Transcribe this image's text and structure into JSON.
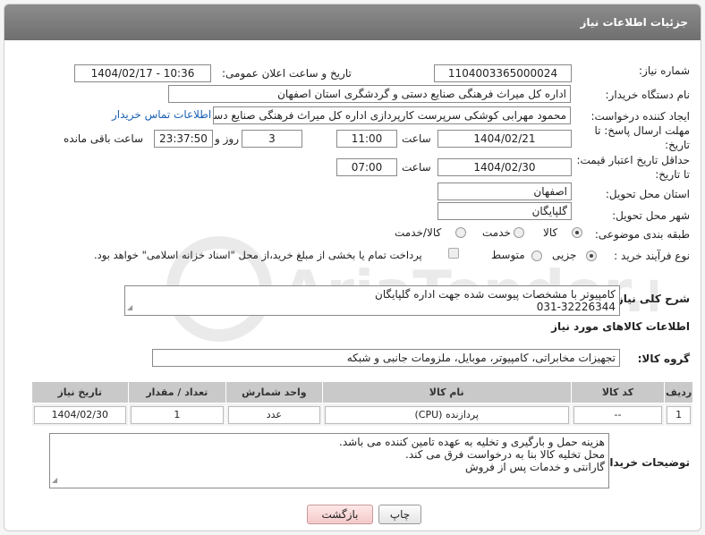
{
  "header": {
    "title": "جزئیات اطلاعات نیاز"
  },
  "fields": {
    "need_number": {
      "label": "شماره نیاز:",
      "value": "1104003365000024"
    },
    "announce": {
      "label": "تاریخ و ساعت اعلان عمومی:",
      "value": "1404/02/17 - 10:36"
    },
    "buyer_org": {
      "label": "نام دستگاه خریدار:",
      "value": "اداره کل میراث فرهنگی  صنایع دستی و گردشگری استان اصفهان"
    },
    "requester": {
      "label": "ایجاد کننده درخواست:",
      "value": "محمود مهرابی کوشکی سرپرست کارپردازی اداره کل میراث فرهنگی  صنایع دستی و گردشگری استان اصفهان",
      "contact_link": "اطلاعات تماس خریدار"
    },
    "reply_deadline": {
      "label_line1": "مهلت ارسال پاسخ: تا",
      "label_line2": "تاریخ:",
      "date": "1404/02/21",
      "time_label": "ساعت",
      "time": "11:00",
      "days": "3",
      "days_label": "روز و",
      "remaining": "23:37:50",
      "remaining_label": "ساعت باقی مانده"
    },
    "price_validity": {
      "label_line1": "حداقل تاریخ اعتبار قیمت:",
      "label_line2": "تا تاریخ:",
      "date": "1404/02/30",
      "time_label": "ساعت",
      "time": "07:00"
    },
    "province": {
      "label": "استان محل تحویل:",
      "value": "اصفهان"
    },
    "city": {
      "label": "شهر محل تحویل:",
      "value": "گلپایگان"
    },
    "category": {
      "label": "طبقه بندی موضوعی:",
      "options": [
        "کالا",
        "خدمت",
        "کالا/خدمت"
      ],
      "selected": "کالا"
    },
    "purchase_type": {
      "label": "نوع فرآیند خرید :",
      "options": [
        "جزیی",
        "متوسط"
      ],
      "selected": "جزیی",
      "note": "پرداخت تمام یا بخشی از مبلغ خرید،از محل \"اسناد خزانه اسلامی\" خواهد بود."
    }
  },
  "description": {
    "label": "شرح کلی نیاز:",
    "line1": "کامپیوتر با مشخصات پیوست شده جهت اداره گلپایگان",
    "line2": "031-32226344"
  },
  "goods_section": {
    "title": "اطلاعات کالاهای مورد نیاز"
  },
  "goods_group": {
    "label": "گروه کالا:",
    "value": "تجهیزات مخابراتی، کامپیوتر، موبایل، ملزومات جانبی و شبکه"
  },
  "table": {
    "headers": [
      "ردیف",
      "کد کالا",
      "نام کالا",
      "واحد شمارش",
      "تعداد / مقدار",
      "تاریخ نیاز"
    ],
    "rows": [
      {
        "row": "1",
        "code": "--",
        "name": "پردازنده (CPU)",
        "unit": "عدد",
        "qty": "1",
        "date": "1404/02/30"
      }
    ]
  },
  "buyer_notes": {
    "label": "توضیحات خریدار:",
    "lines": [
      "هزینه حمل و بارگیری و تخلیه به عهده تامین کننده می باشد.",
      "محل تخلیه کالا بنا به درخواست فرق می کند.",
      "گارانتی و خدمات پس از فروش"
    ]
  },
  "buttons": {
    "print": "چاپ",
    "back": "بازگشت"
  },
  "watermark": {
    "text": "AriaTender.neT"
  }
}
